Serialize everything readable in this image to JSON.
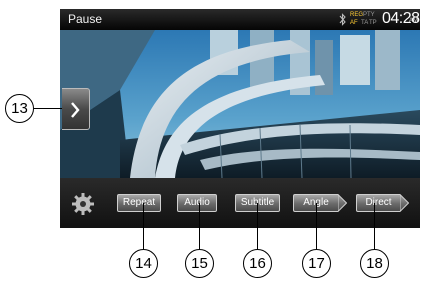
{
  "status_bar": {
    "state": "Pause",
    "indicators": {
      "reg": "REG",
      "pty": "PTY",
      "af": "AF",
      "ta": "TA",
      "tp": "TP"
    },
    "time": "04:28",
    "ampm": "AM"
  },
  "controls": {
    "repeat": "Repeat",
    "audio": "Audio",
    "subtitle": "Subtitle",
    "angle": "Angle",
    "direct": "Direct"
  },
  "callouts": [
    "13",
    "14",
    "15",
    "16",
    "17",
    "18"
  ],
  "icons": [
    "bluetooth-icon",
    "gear-icon",
    "chevron-right-icon"
  ],
  "colors": {
    "button_gray": "#6a6a6a",
    "bar_dark": "#111111",
    "sky": "#2f78a8"
  }
}
